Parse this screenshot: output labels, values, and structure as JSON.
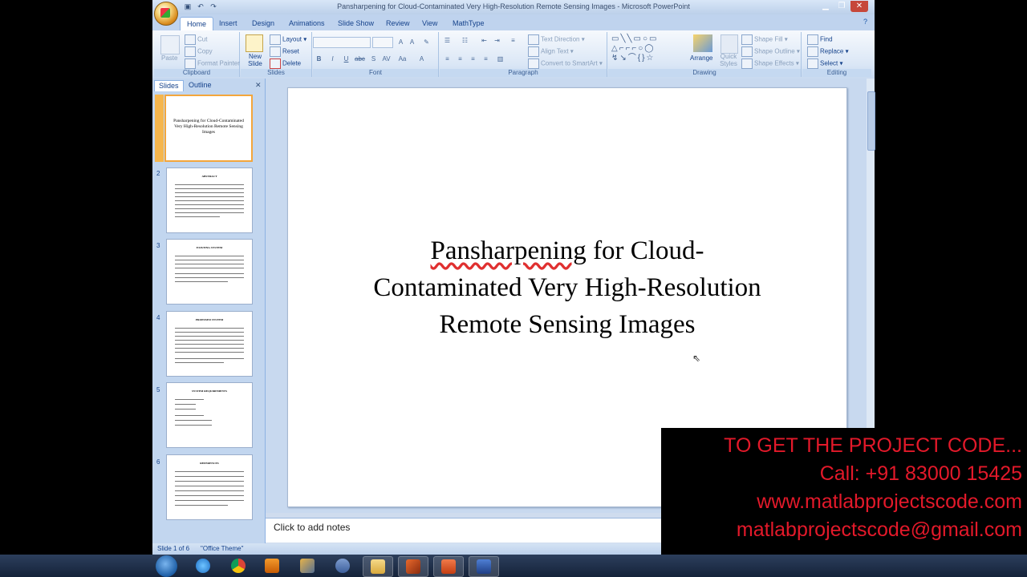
{
  "window": {
    "title": "Pansharpening for Cloud-Contaminated Very High-Resolution Remote Sensing Images - Microsoft PowerPoint"
  },
  "ribbon_tabs": [
    "Home",
    "Insert",
    "Design",
    "Animations",
    "Slide Show",
    "Review",
    "View",
    "MathType"
  ],
  "clipboard": {
    "paste": "Paste",
    "cut": "Cut",
    "copy": "Copy",
    "format_painter": "Format Painter",
    "label": "Clipboard"
  },
  "slides_group": {
    "new_slide": "New Slide",
    "layout": "Layout",
    "reset": "Reset",
    "delete": "Delete",
    "label": "Slides"
  },
  "font_group": {
    "label": "Font",
    "bold": "B",
    "italic": "I",
    "underline": "U",
    "abc": "abc",
    "s": "S",
    "av": "AV",
    "aa": "Aa",
    "a": "A"
  },
  "paragraph_group": {
    "text_direction": "Text Direction",
    "align_text": "Align Text",
    "convert_smartart": "Convert to SmartArt",
    "label": "Paragraph"
  },
  "drawing_group": {
    "arrange": "Arrange",
    "quick_styles": "Quick Styles",
    "shape_fill": "Shape Fill",
    "shape_outline": "Shape Outline",
    "shape_effects": "Shape Effects",
    "label": "Drawing"
  },
  "editing_group": {
    "find": "Find",
    "replace": "Replace",
    "select": "Select",
    "label": "Editing"
  },
  "pane": {
    "tab_slides": "Slides",
    "tab_outline": "Outline"
  },
  "thumbnails": [
    {
      "num": "1",
      "title": "Pansharpening for Cloud-Contaminated Very High-Resolution Remote Sensing Images"
    },
    {
      "num": "2",
      "heading": "ABSTRACT"
    },
    {
      "num": "3",
      "heading": "EXISTING SYSTEM"
    },
    {
      "num": "4",
      "heading": "PROPOSED SYSTEM"
    },
    {
      "num": "5",
      "heading": "SYSTEM REQUIREMENTS"
    },
    {
      "num": "6",
      "heading": "REFERENCES"
    }
  ],
  "slide": {
    "title_line1": "Pansharpening for Cloud-",
    "title_line2": "Contaminated Very High-Resolution",
    "title_line3": "Remote Sensing Images"
  },
  "notes_placeholder": "Click to add notes",
  "status": {
    "slide_of": "Slide 1 of 6",
    "theme": "\"Office Theme\""
  },
  "overlay": {
    "line1": "TO GET THE PROJECT CODE...",
    "line2": "Call: +91 83000 15425",
    "line3": "www.matlabprojectscode.com",
    "line4": "matlabprojectscode@gmail.com",
    "color": "#e3192a"
  },
  "taskbar_icons": [
    "windows-start",
    "internet-explorer",
    "chrome",
    "media-player",
    "tools",
    "link",
    "file-explorer",
    "matlab",
    "powerpoint",
    "app"
  ]
}
